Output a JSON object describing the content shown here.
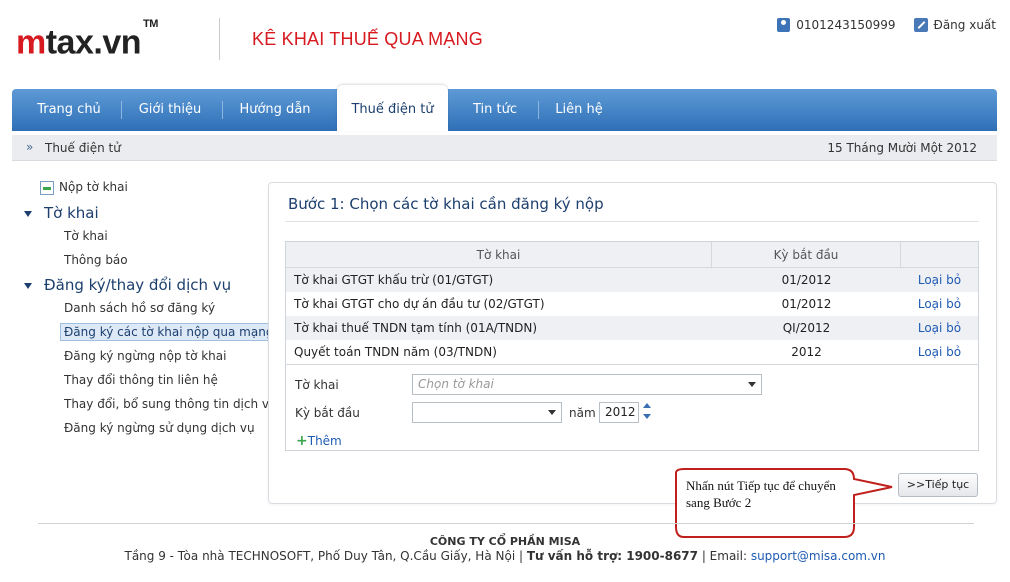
{
  "header": {
    "logo_prefix": "m",
    "logo_rest": "tax.vn",
    "logo_tm": "TM",
    "app_title": "KÊ KHAI THUẾ QUA MẠNG",
    "user_id": "0101243150999",
    "logout_label": "Đăng xuất"
  },
  "nav": {
    "items": [
      {
        "label": "Trang chủ"
      },
      {
        "label": "Giới thiệu"
      },
      {
        "label": "Hướng dẫn"
      },
      {
        "label": "Thuế điện tử"
      },
      {
        "label": "Tin tức"
      },
      {
        "label": "Liên hệ"
      }
    ],
    "active": "Thuế điện tử"
  },
  "breadcrumb": {
    "current": "Thuế điện tử",
    "date": "15 Tháng Mười Một 2012"
  },
  "sidebar": {
    "top_link": "Nộp tờ khai",
    "section1": {
      "title": "Tờ khai",
      "items": [
        "Tờ khai",
        "Thông báo"
      ]
    },
    "section2": {
      "title": "Đăng ký/thay đổi dịch vụ",
      "items": [
        "Danh sách hồ sơ đăng ký",
        "Đăng ký các tờ khai nộp qua mạng",
        "Đăng ký ngừng nộp tờ khai",
        "Thay đổi thông tin liên hệ",
        "Thay đổi, bổ sung thông tin dịch vụ",
        "Đăng ký ngừng sử dụng dịch vụ"
      ],
      "selected": "Đăng ký các tờ khai nộp qua mạng"
    }
  },
  "panel": {
    "title": "Bước 1: Chọn các tờ khai cần đăng ký nộp",
    "columns": [
      "Tờ khai",
      "Kỳ bắt đầu",
      ""
    ],
    "rows": [
      {
        "name": "Tờ khai GTGT khấu trừ (01/GTGT)",
        "period": "01/2012",
        "action": "Loại bỏ"
      },
      {
        "name": "Tờ khai GTGT cho dự án đầu tư (02/GTGT)",
        "period": "01/2012",
        "action": "Loại bỏ"
      },
      {
        "name": "Tờ khai thuế TNDN tạm tính (01A/TNDN)",
        "period": "QI/2012",
        "action": "Loại bỏ"
      },
      {
        "name": "Quyết toán TNDN năm (03/TNDN)",
        "period": "2012",
        "action": "Loại bỏ"
      }
    ],
    "form": {
      "tokhai_label": "Tờ khai",
      "tokhai_placeholder": "Chọn tờ khai",
      "kybatdau_label": "Kỳ bắt đầu",
      "kybatdau_value": "",
      "nam_label": "năm",
      "nam_value": "2012",
      "add_label": "Thêm"
    },
    "next_button": ">>Tiếp tục"
  },
  "callout": {
    "text": "Nhấn nút Tiếp tục để chuyển sang Bước 2"
  },
  "footer": {
    "company": "CÔNG TY CỔ PHẦN MISA",
    "address": "Tầng 9 - Tòa nhà TECHNOSOFT, Phố Duy Tân, Q.Cầu Giấy, Hà Nội | ",
    "hotline": "Tư vấn hỗ trợ: 1900-8677",
    "email_label": " | Email: ",
    "email": "support@misa.com.vn"
  },
  "colors": {
    "brand_red": "#d71920",
    "nav_blue": "#2f6fb6",
    "link_blue": "#1f5bb3",
    "heading_blue": "#1c3f6e"
  }
}
